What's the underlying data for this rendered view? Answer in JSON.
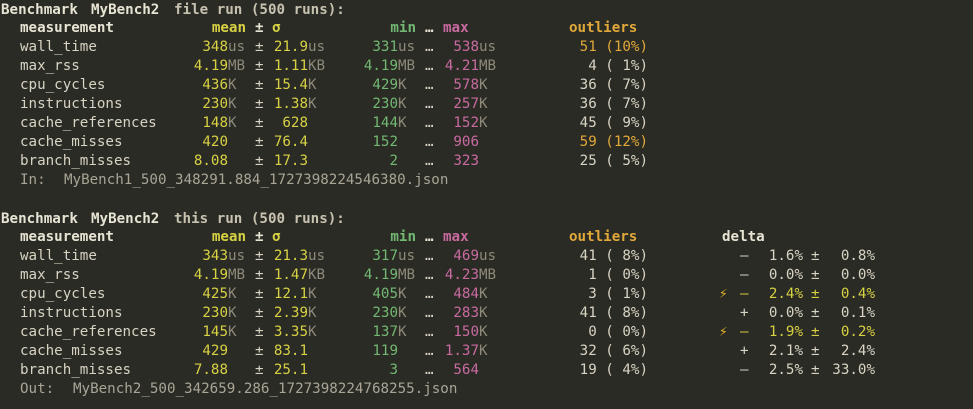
{
  "colors": {
    "background": "#2b2b25",
    "text": "#d8d4c4",
    "mean": "#d7d144",
    "min": "#72b872",
    "max": "#c86aa0",
    "outliers_header": "#e1a83a",
    "unit": "#8e8a7a"
  },
  "sections": [
    {
      "title": {
        "prefix": "Benchmark",
        "name": "MyBench2",
        "suffix": "file run (500 runs):"
      },
      "headers": {
        "measurement": "measurement",
        "mean": "mean",
        "pm": "±",
        "sigma": "σ",
        "min": "min",
        "ellipsis": "…",
        "max": "max",
        "outliers": "outliers",
        "delta": ""
      },
      "rows": [
        {
          "name": "wall_time",
          "mean": "348",
          "mean_unit": "us",
          "pm": "±",
          "sd": "21.9",
          "sd_unit": "us",
          "min": "331",
          "min_unit": "us",
          "ell": "…",
          "max": "538",
          "max_unit": "us",
          "outliers": "51 (10%)",
          "out_warn": true
        },
        {
          "name": "max_rss",
          "mean": "4.19",
          "mean_unit": "MB",
          "pm": "±",
          "sd": "1.11",
          "sd_unit": "KB",
          "min": "4.19",
          "min_unit": "MB",
          "ell": "…",
          "max": "4.21",
          "max_unit": "MB",
          "outliers": "4 ( 1%)",
          "out_warn": false
        },
        {
          "name": "cpu_cycles",
          "mean": "436",
          "mean_unit": "K",
          "pm": "±",
          "sd": "15.4",
          "sd_unit": "K",
          "min": "429",
          "min_unit": "K",
          "ell": "…",
          "max": "578",
          "max_unit": "K",
          "outliers": "36 ( 7%)",
          "out_warn": false
        },
        {
          "name": "instructions",
          "mean": "230",
          "mean_unit": "K",
          "pm": "±",
          "sd": "1.38",
          "sd_unit": "K",
          "min": "230",
          "min_unit": "K",
          "ell": "…",
          "max": "257",
          "max_unit": "K",
          "outliers": "36 ( 7%)",
          "out_warn": false
        },
        {
          "name": "cache_references",
          "mean": "148",
          "mean_unit": "K",
          "pm": "±",
          "sd": "628",
          "sd_unit": "",
          "min": "144",
          "min_unit": "K",
          "ell": "…",
          "max": "152",
          "max_unit": "K",
          "outliers": "45 ( 9%)",
          "out_warn": false
        },
        {
          "name": "cache_misses",
          "mean": "420",
          "mean_unit": "",
          "pm": "±",
          "sd": "76.4",
          "sd_unit": "",
          "min": "152",
          "min_unit": "",
          "ell": "…",
          "max": "906",
          "max_unit": "",
          "outliers": "59 (12%)",
          "out_warn": true
        },
        {
          "name": "branch_misses",
          "mean": "8.08",
          "mean_unit": "",
          "pm": "±",
          "sd": "17.3",
          "sd_unit": "",
          "min": "2",
          "min_unit": "",
          "ell": "…",
          "max": "323",
          "max_unit": "",
          "outliers": "25 ( 5%)",
          "out_warn": false
        }
      ],
      "path": {
        "label": "In:",
        "value": "MyBench1_500_348291.884_1727398224546380.json"
      }
    },
    {
      "title": {
        "prefix": "Benchmark",
        "name": "MyBench2",
        "suffix": "this run (500 runs):"
      },
      "headers": {
        "measurement": "measurement",
        "mean": "mean",
        "pm": "±",
        "sigma": "σ",
        "min": "min",
        "ellipsis": "…",
        "max": "max",
        "outliers": "outliers",
        "delta": "delta"
      },
      "rows": [
        {
          "name": "wall_time",
          "mean": "343",
          "mean_unit": "us",
          "pm": "±",
          "sd": "21.3",
          "sd_unit": "us",
          "min": "317",
          "min_unit": "us",
          "ell": "…",
          "max": "469",
          "max_unit": "us",
          "outliers": "41 ( 8%)",
          "out_warn": false,
          "bolt": "",
          "sign": "–",
          "delta": "1.6%",
          "delta_pm": "±",
          "delta_sd": "0.8%",
          "gain": false
        },
        {
          "name": "max_rss",
          "mean": "4.19",
          "mean_unit": "MB",
          "pm": "±",
          "sd": "1.47",
          "sd_unit": "KB",
          "min": "4.19",
          "min_unit": "MB",
          "ell": "…",
          "max": "4.23",
          "max_unit": "MB",
          "outliers": "1 ( 0%)",
          "out_warn": false,
          "bolt": "",
          "sign": "–",
          "delta": "0.0%",
          "delta_pm": "±",
          "delta_sd": "0.0%",
          "gain": false
        },
        {
          "name": "cpu_cycles",
          "mean": "425",
          "mean_unit": "K",
          "pm": "±",
          "sd": "12.1",
          "sd_unit": "K",
          "min": "405",
          "min_unit": "K",
          "ell": "…",
          "max": "484",
          "max_unit": "K",
          "outliers": "3 ( 1%)",
          "out_warn": false,
          "bolt": "⚡",
          "sign": "–",
          "delta": "2.4%",
          "delta_pm": "±",
          "delta_sd": "0.4%",
          "gain": true
        },
        {
          "name": "instructions",
          "mean": "230",
          "mean_unit": "K",
          "pm": "±",
          "sd": "2.39",
          "sd_unit": "K",
          "min": "230",
          "min_unit": "K",
          "ell": "…",
          "max": "283",
          "max_unit": "K",
          "outliers": "41 ( 8%)",
          "out_warn": false,
          "bolt": "",
          "sign": "+",
          "delta": "0.0%",
          "delta_pm": "±",
          "delta_sd": "0.1%",
          "gain": false
        },
        {
          "name": "cache_references",
          "mean": "145",
          "mean_unit": "K",
          "pm": "±",
          "sd": "3.35",
          "sd_unit": "K",
          "min": "137",
          "min_unit": "K",
          "ell": "…",
          "max": "150",
          "max_unit": "K",
          "outliers": "0 ( 0%)",
          "out_warn": false,
          "bolt": "⚡",
          "sign": "–",
          "delta": "1.9%",
          "delta_pm": "±",
          "delta_sd": "0.2%",
          "gain": true
        },
        {
          "name": "cache_misses",
          "mean": "429",
          "mean_unit": "",
          "pm": "±",
          "sd": "83.1",
          "sd_unit": "",
          "min": "119",
          "min_unit": "",
          "ell": "…",
          "max": "1.37",
          "max_unit": "K",
          "outliers": "32 ( 6%)",
          "out_warn": false,
          "bolt": "",
          "sign": "+",
          "delta": "2.1%",
          "delta_pm": "±",
          "delta_sd": "2.4%",
          "gain": false
        },
        {
          "name": "branch_misses",
          "mean": "7.88",
          "mean_unit": "",
          "pm": "±",
          "sd": "25.1",
          "sd_unit": "",
          "min": "3",
          "min_unit": "",
          "ell": "…",
          "max": "564",
          "max_unit": "",
          "outliers": "19 ( 4%)",
          "out_warn": false,
          "bolt": "",
          "sign": "–",
          "delta": "2.5%",
          "delta_pm": "±",
          "delta_sd": "33.0%",
          "gain": false
        }
      ],
      "path": {
        "label": "Out:",
        "value": "MyBench2_500_342659.286_1727398224768255.json"
      }
    }
  ]
}
